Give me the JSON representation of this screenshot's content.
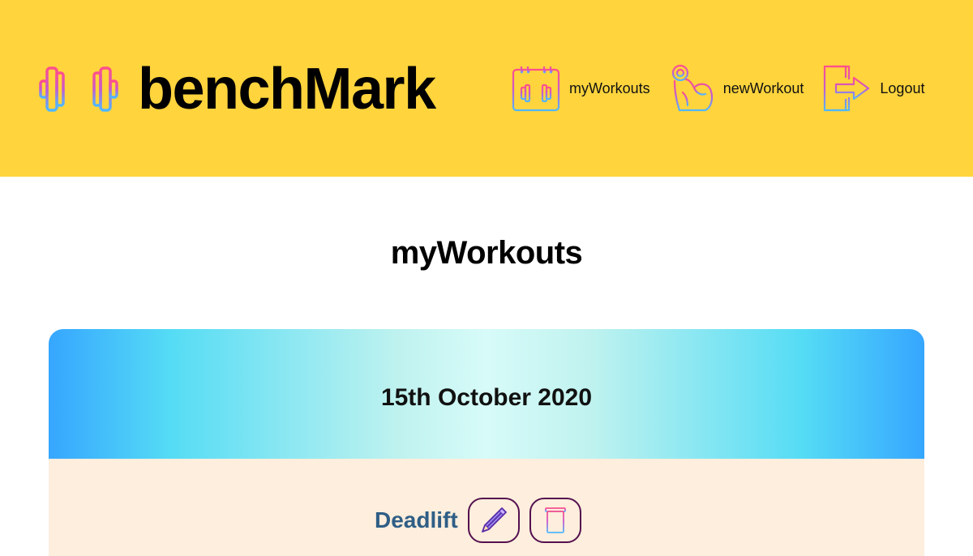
{
  "header": {
    "brand": "benchMark",
    "nav": [
      {
        "label": "myWorkouts",
        "icon": "calendar-dumbbell-icon"
      },
      {
        "label": "newWorkout",
        "icon": "flexed-arm-icon"
      },
      {
        "label": "Logout",
        "icon": "logout-door-icon"
      }
    ],
    "background": "#ffd43d"
  },
  "main": {
    "title": "myWorkouts",
    "workouts": [
      {
        "date": "15th October 2020",
        "exercises": [
          {
            "name": "Deadlift",
            "actions": [
              "edit-icon",
              "trash-icon"
            ]
          }
        ]
      }
    ]
  },
  "colors": {
    "icon_gradient": [
      "#ff4f8b",
      "#c45ad0",
      "#4fb8ff"
    ],
    "exercise_name": "#2f5e86",
    "card_body": "#fdeedd",
    "button_border": "#54104f"
  }
}
